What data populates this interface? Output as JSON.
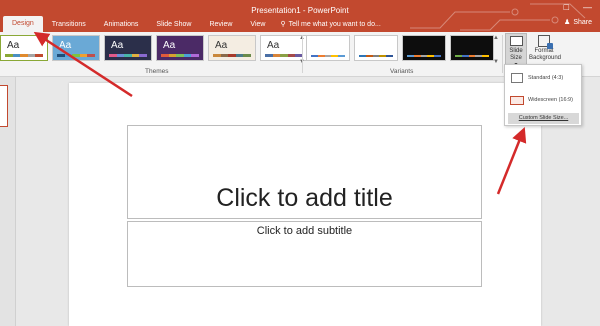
{
  "window": {
    "title": "Presentation1 - PowerPoint"
  },
  "tabs": [
    {
      "label": "Design",
      "active": true
    },
    {
      "label": "Transitions"
    },
    {
      "label": "Animations"
    },
    {
      "label": "Slide Show"
    },
    {
      "label": "Review"
    },
    {
      "label": "View"
    }
  ],
  "tell_me": "Tell me what you want to do...",
  "share_label": "Share",
  "ribbon": {
    "themes_label": "Themes",
    "variants_label": "Variants",
    "theme_sample": "Aa",
    "slide_size_label": "Slide Size",
    "format_background_line1": "Format",
    "format_background_line2": "Background"
  },
  "themes": [
    {
      "bg": "#ffffff",
      "text": "#2b2b2b",
      "bars": [
        "#8aa836",
        "#4a90c2",
        "#e08a2e",
        "#a5a5a5",
        "#c04a2f"
      ]
    },
    {
      "bg": "#6aa9d6",
      "text": "#ffffff",
      "bars": [
        "#1f4e79",
        "#4aa3df",
        "#7fc241",
        "#f0a030",
        "#c0504d"
      ]
    },
    {
      "bg": "#2b2f4a",
      "text": "#ffffff",
      "bars": [
        "#e05a8a",
        "#6a8fd8",
        "#47b5a8",
        "#e0b040",
        "#8a6ad0"
      ]
    },
    {
      "bg": "#4b2a66",
      "text": "#ffffff",
      "bars": [
        "#e05a3c",
        "#d8a030",
        "#7ec05a",
        "#4aa0d8",
        "#b06ad8"
      ]
    },
    {
      "bg": "#f4ede2",
      "text": "#333333",
      "bars": [
        "#c9873a",
        "#8a6a4a",
        "#a83a2a",
        "#4a7a8a",
        "#6a8a4a"
      ]
    },
    {
      "bg": "#ffffff",
      "text": "#333333",
      "bars": [
        "#4a6fa5",
        "#d8843a",
        "#8aa045",
        "#a54a4a",
        "#6a5aa0"
      ]
    }
  ],
  "variants": [
    {
      "bg": "#ffffff",
      "bars": [
        "#4472c4",
        "#ed7d31",
        "#a5a5a5",
        "#ffc000",
        "#5b9bd5"
      ]
    },
    {
      "bg": "#ffffff",
      "bars": [
        "#2e75b6",
        "#c55a11",
        "#7f7f7f",
        "#bf9000",
        "#2f5597"
      ]
    },
    {
      "bg": "#0d0d0d",
      "bars": [
        "#5b9bd5",
        "#ed7d31",
        "#a5a5a5",
        "#ffc000",
        "#4472c4"
      ]
    },
    {
      "bg": "#0d0d0d",
      "bars": [
        "#70ad47",
        "#4472c4",
        "#ed7d31",
        "#a5a5a5",
        "#ffc000"
      ]
    }
  ],
  "slide_size_menu": {
    "standard": "Standard (4:3)",
    "widescreen": "Widescreen (16:9)",
    "custom": "Custom Slide Size..."
  },
  "slide": {
    "title_placeholder": "Click to add title",
    "subtitle_placeholder": "Click to add subtitle"
  },
  "colors": {
    "accent": "#c2492f",
    "annotation_arrow": "#d42a2a"
  }
}
